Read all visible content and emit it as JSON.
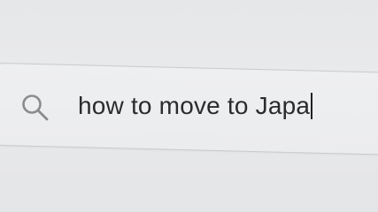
{
  "search": {
    "value": "how to move to Japa",
    "icon": "search-icon"
  },
  "colors": {
    "background": "#e7e8ea",
    "box_border": "#c9cacc",
    "text": "#2a2b2d",
    "icon": "#8a8b8d"
  }
}
